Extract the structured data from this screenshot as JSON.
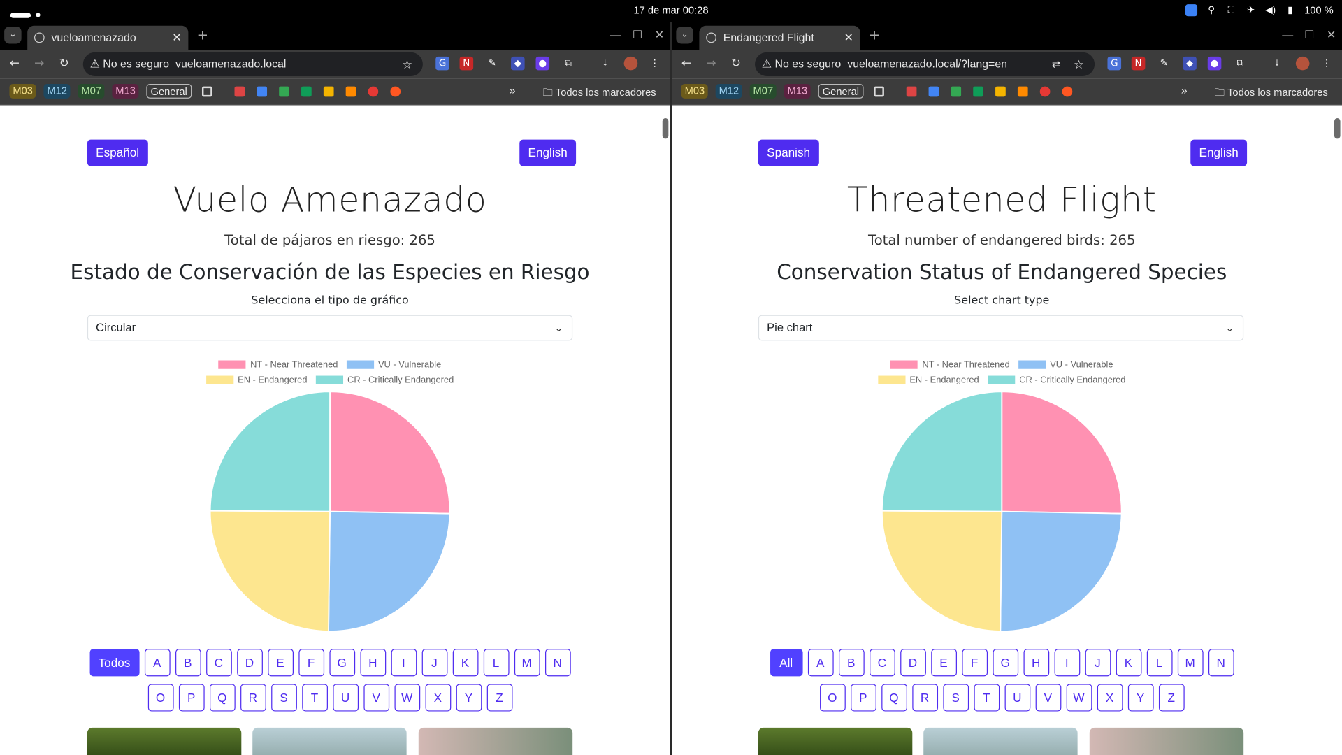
{
  "system": {
    "clock": "17 de mar  00:28",
    "battery": "100 %"
  },
  "left": {
    "tab_title": "vueloamenazado",
    "insecure_label": "No es seguro",
    "url": "vueloamenazado.local",
    "bookmarks": [
      "M03",
      "M12",
      "M07",
      "M13",
      "General"
    ],
    "bookmarks_all": "Todos los marcadores",
    "lang_btn_1": "Español",
    "lang_btn_2": "English",
    "title": "Vuelo Amenazado",
    "total": "Total de pájaros en riesgo: 265",
    "subtitle": "Estado de Conservación de las Especies en Riesgo",
    "select_label": "Selecciona el tipo de gráfico",
    "select_value": "Circular",
    "all_label": "Todos"
  },
  "right": {
    "tab_title": "Endangered Flight",
    "insecure_label": "No es seguro",
    "url": "vueloamenazado.local/?lang=en",
    "bookmarks": [
      "M03",
      "M12",
      "M07",
      "M13",
      "General"
    ],
    "bookmarks_all": "Todos los marcadores",
    "lang_btn_1": "Spanish",
    "lang_btn_2": "English",
    "title": "Threatened Flight",
    "total": "Total number of endangered birds: 265",
    "subtitle": "Conservation Status of Endangered Species",
    "select_label": "Select chart type",
    "select_value": "Pie chart",
    "all_label": "All"
  },
  "letters_row1": [
    "A",
    "B",
    "C",
    "D",
    "E",
    "F",
    "G",
    "H",
    "I",
    "J",
    "K",
    "L",
    "M",
    "N"
  ],
  "letters_row2": [
    "O",
    "P",
    "Q",
    "R",
    "S",
    "T",
    "U",
    "V",
    "W",
    "X",
    "Y",
    "Z"
  ],
  "chart_data": {
    "type": "pie",
    "categories": [
      "NT - Near Threatened",
      "VU - Vulnerable",
      "EN - Endangered",
      "CR - Critically Endangered"
    ],
    "values": [
      67,
      66,
      66,
      66
    ],
    "colors": [
      "#ff91b2",
      "#8fc1f4",
      "#fde68f",
      "#86dcd9"
    ],
    "legend": "top"
  },
  "colors": {
    "accent": "#4f2cf0",
    "all_button": "#5141ff"
  }
}
